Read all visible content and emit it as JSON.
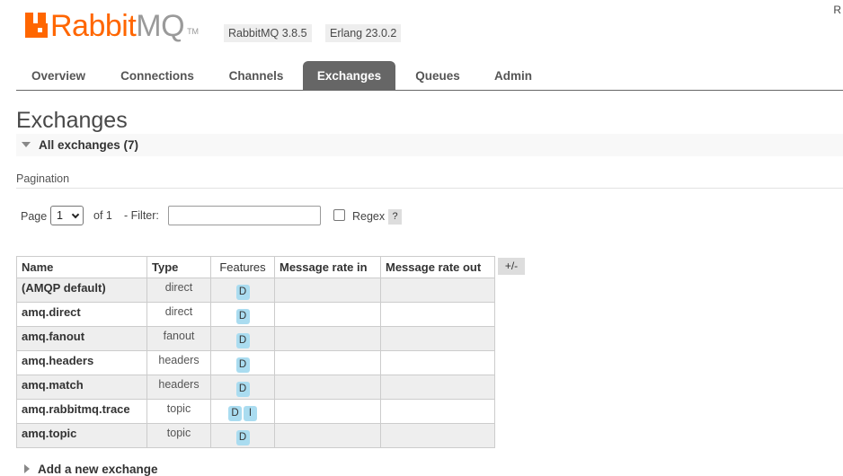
{
  "header": {
    "logo_rabbit": "Rabbit",
    "logo_mq": "MQ",
    "logo_tm": "TM",
    "rabbitmq_version": "RabbitMQ 3.8.5",
    "erlang_version": "Erlang 23.0.2",
    "user_initial": "R"
  },
  "tabs": [
    {
      "label": "Overview"
    },
    {
      "label": "Connections"
    },
    {
      "label": "Channels"
    },
    {
      "label": "Exchanges",
      "active": true
    },
    {
      "label": "Queues"
    },
    {
      "label": "Admin"
    }
  ],
  "page_title": "Exchanges",
  "section": {
    "title": "All exchanges (7)"
  },
  "pagination": {
    "heading": "Pagination",
    "page_label": "Page",
    "page_value": "1",
    "of_label": "of 1",
    "filter_label": "- Filter:",
    "filter_value": "",
    "regex_label": "Regex",
    "regex_checked": false,
    "help_label": "?"
  },
  "table": {
    "columns": [
      "Name",
      "Type",
      "Features",
      "Message rate in",
      "Message rate out"
    ],
    "plus_minus": "+/-",
    "rows": [
      {
        "name": "(AMQP default)",
        "type": "direct",
        "features": [
          "D"
        ],
        "rate_in": "",
        "rate_out": ""
      },
      {
        "name": "amq.direct",
        "type": "direct",
        "features": [
          "D"
        ],
        "rate_in": "",
        "rate_out": ""
      },
      {
        "name": "amq.fanout",
        "type": "fanout",
        "features": [
          "D"
        ],
        "rate_in": "",
        "rate_out": ""
      },
      {
        "name": "amq.headers",
        "type": "headers",
        "features": [
          "D"
        ],
        "rate_in": "",
        "rate_out": ""
      },
      {
        "name": "amq.match",
        "type": "headers",
        "features": [
          "D"
        ],
        "rate_in": "",
        "rate_out": ""
      },
      {
        "name": "amq.rabbitmq.trace",
        "type": "topic",
        "features": [
          "D",
          "I"
        ],
        "rate_in": "",
        "rate_out": ""
      },
      {
        "name": "amq.topic",
        "type": "topic",
        "features": [
          "D"
        ],
        "rate_in": "",
        "rate_out": ""
      }
    ]
  },
  "add_exchange_label": "Add a new exchange",
  "colors": {
    "brand_orange": "#ff6600",
    "active_tab": "#666666",
    "feature_badge": "#aadcf0"
  }
}
